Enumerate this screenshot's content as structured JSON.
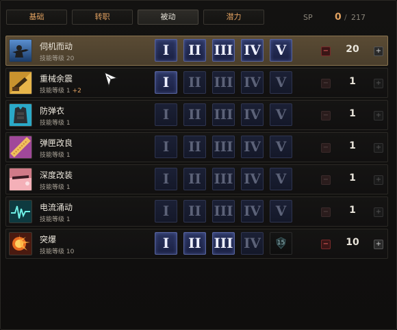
{
  "tabs": [
    {
      "label": "基础",
      "active": false
    },
    {
      "label": "转职",
      "active": false
    },
    {
      "label": "被动",
      "active": true
    },
    {
      "label": "潜力",
      "active": false
    }
  ],
  "sp": {
    "label": "SP",
    "current": "0",
    "slash": "/",
    "total": "217"
  },
  "tier_labels": [
    "I",
    "II",
    "III",
    "IV",
    "V"
  ],
  "skills": [
    {
      "name": "伺机而动",
      "level": "技能等级 20",
      "bonus": "",
      "count": "20",
      "tiers_on": 5,
      "selected": true,
      "icon": "sniper-icon",
      "locked_tier": ""
    },
    {
      "name": "重械余震",
      "level": "技能等级 1",
      "bonus": "+2",
      "count": "1",
      "tiers_on": 1,
      "selected": false,
      "icon": "heavy-weapon-icon",
      "locked_tier": ""
    },
    {
      "name": "防弹衣",
      "level": "技能等级 1",
      "bonus": "",
      "count": "1",
      "tiers_on": 0,
      "selected": false,
      "icon": "vest-icon",
      "locked_tier": ""
    },
    {
      "name": "弹匣改良",
      "level": "技能等级 1",
      "bonus": "",
      "count": "1",
      "tiers_on": 0,
      "selected": false,
      "icon": "magazine-icon",
      "locked_tier": ""
    },
    {
      "name": "深度改装",
      "level": "技能等级 1",
      "bonus": "",
      "count": "1",
      "tiers_on": 0,
      "selected": false,
      "icon": "modify-icon",
      "locked_tier": ""
    },
    {
      "name": "电流涌动",
      "level": "技能等级 1",
      "bonus": "",
      "count": "1",
      "tiers_on": 0,
      "selected": false,
      "icon": "current-icon",
      "locked_tier": ""
    },
    {
      "name": "突爆",
      "level": "技能等级 10",
      "bonus": "",
      "count": "10",
      "tiers_on": 3,
      "selected": false,
      "icon": "burst-icon",
      "locked_tier": "15"
    }
  ]
}
